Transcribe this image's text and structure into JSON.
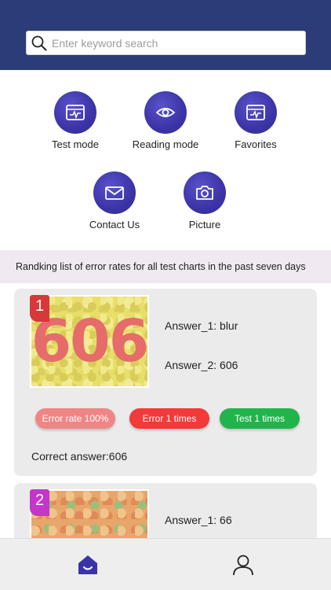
{
  "search": {
    "placeholder": "Enter keyword search"
  },
  "menu": [
    {
      "label": "Test mode",
      "icon": "browser-chart-icon"
    },
    {
      "label": "Reading mode",
      "icon": "eye-icon"
    },
    {
      "label": "Favorites",
      "icon": "browser-chart-icon"
    },
    {
      "label": "Contact Us",
      "icon": "mail-icon"
    },
    {
      "label": "Picture",
      "icon": "camera-icon"
    }
  ],
  "banner": "Randking list of error rates for all test charts in the past seven days",
  "cards": [
    {
      "rank": "1",
      "plate_number": "606",
      "answer_1": "Answer_1: blur",
      "answer_2": "Answer_2: 606",
      "error_rate": "Error rate 100%",
      "error_count": "Error 1 times",
      "test_count": "Test 1 times",
      "correct_answer": "Correct answer:606"
    },
    {
      "rank": "2",
      "answer_1": "Answer_1: 66"
    }
  ],
  "colors": {
    "header": "#2b3c78",
    "icon_circle": "#3b33a6",
    "banner": "#f1e9f1",
    "rank1": "#d7383a",
    "rank2": "#c336c9",
    "error_rate_pill": "#f08585",
    "error_pill": "#f23a3a",
    "test_pill": "#22b44c"
  },
  "tabbar": [
    {
      "icon": "home-icon",
      "active": true
    },
    {
      "icon": "user-icon",
      "active": false
    }
  ]
}
